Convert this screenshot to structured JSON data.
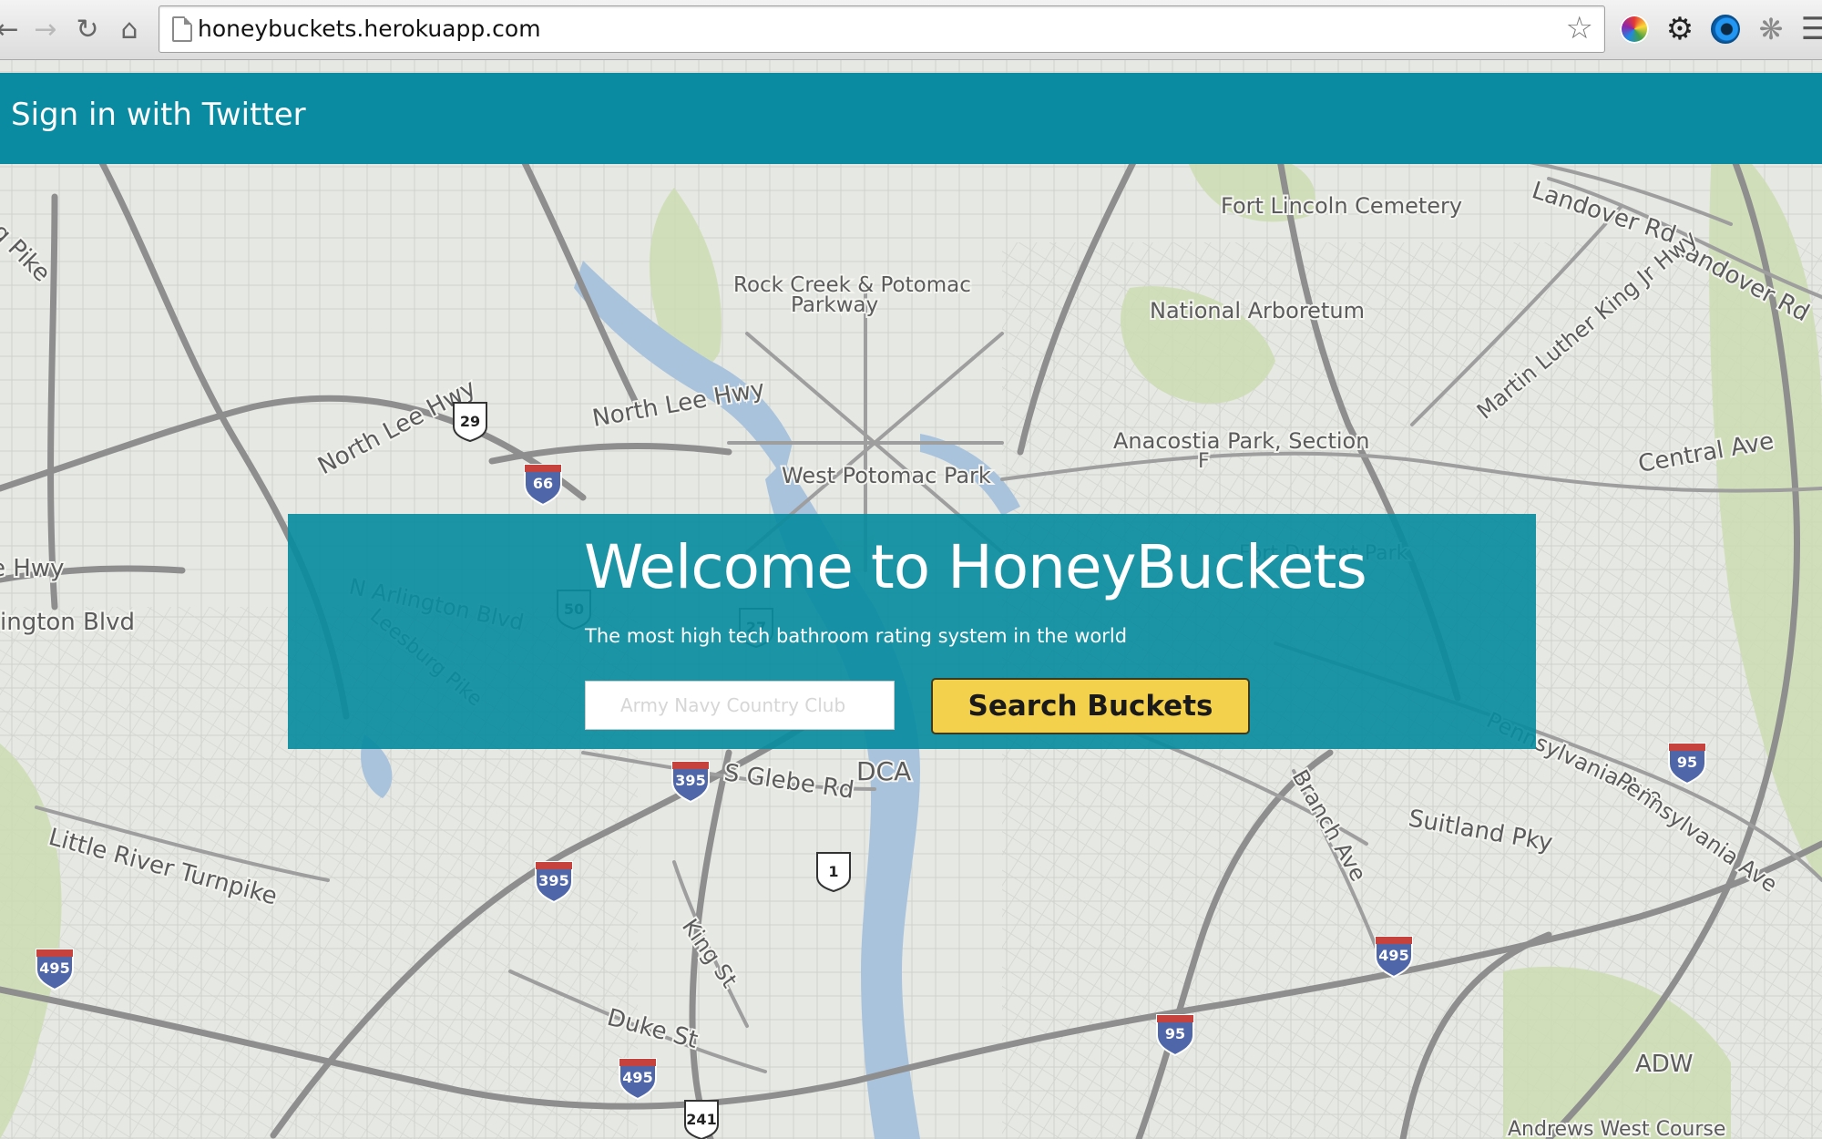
{
  "browser": {
    "url": "honeybuckets.herokuapp.com",
    "icons": [
      "back-arrow-icon",
      "forward-arrow-icon",
      "reload-icon",
      "home-icon",
      "page-icon",
      "star-icon",
      "color-wheel-icon",
      "gear-icon",
      "eye-icon",
      "bug-icon",
      "menu-icon"
    ]
  },
  "header": {
    "signin_label": "Sign in with Twitter",
    "background_color": "#0b8ba1"
  },
  "hero": {
    "title": "Welcome to HoneyBuckets",
    "subtitle": "The most high tech bathroom rating system in the world",
    "search_placeholder": "Army Navy Country Club",
    "search_value": "",
    "search_button_label": "Search Buckets",
    "panel_color": "#0a8ca0",
    "button_color": "#f4d14d"
  },
  "map": {
    "labels": [
      "Landover Rd",
      "Landover Rd",
      "Fort Lincoln Cemetery",
      "Rock Creek & Potomac",
      "Parkway",
      "National Arboretum",
      "Martin Luther King Jr Hwy",
      "North Lee Hwy",
      "North Lee Hwy",
      "Anacostia Park, Section",
      "F",
      "Central Ave",
      "West Potomac Park",
      "Fort Dupont Park",
      "N Arlington Blvd",
      "Leesburg Pike",
      "ington Blvd",
      "e Hwy",
      "g Pike",
      "S Glebe Rd",
      "DCA",
      "Pennsylvania Ave",
      "Pennsylvania Ave",
      "Branch Ave",
      "Suitland Pky",
      "Little River Turnpike",
      "King St",
      "Duke St",
      "ADW",
      "Andrews West Course"
    ],
    "shields": [
      "29",
      "66",
      "50",
      "27",
      "395",
      "395",
      "1",
      "495",
      "495",
      "495",
      "95",
      "95",
      "241"
    ]
  }
}
